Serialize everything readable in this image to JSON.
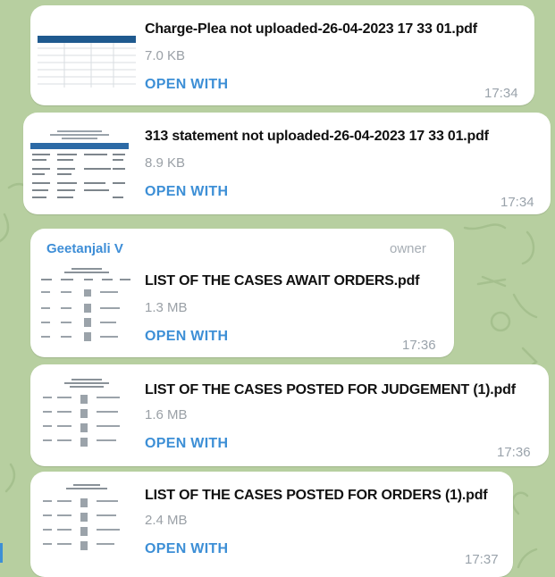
{
  "messages": [
    {
      "file_name": "Charge-Plea not uploaded-26-04-2023 17 33 01.pdf",
      "size": "7.0 KB",
      "action": "OPEN WITH",
      "time": "17:34",
      "thumb": "blue-header-table-icon"
    },
    {
      "file_name": "313 statement not uploaded-26-04-2023 17 33 01.pdf",
      "size": "8.9 KB",
      "action": "OPEN WITH",
      "time": "17:34",
      "thumb": "blue-header-document-icon"
    },
    {
      "sender": "Geetanjali V",
      "role": "owner",
      "file_name": "LIST OF THE CASES  AWAIT ORDERS.pdf",
      "size": "1.3 MB",
      "action": "OPEN WITH",
      "time": "17:36",
      "thumb": "document-list-icon"
    },
    {
      "file_name": "LIST OF THE CASES POSTED FOR JUDGEMENT (1).pdf",
      "size": "1.6 MB",
      "action": "OPEN WITH",
      "time": "17:36",
      "thumb": "document-list-icon"
    },
    {
      "file_name": "LIST OF THE CASES POSTED FOR ORDERS (1).pdf",
      "size": "2.4 MB",
      "action": "OPEN WITH",
      "time": "17:37",
      "thumb": "document-list-icon"
    }
  ],
  "colors": {
    "background": "#b7cfa0",
    "bubble": "#ffffff",
    "accent_link": "#3d8fd6",
    "sender_name": "#3e8ed7",
    "meta_text": "#9aa3ab"
  }
}
